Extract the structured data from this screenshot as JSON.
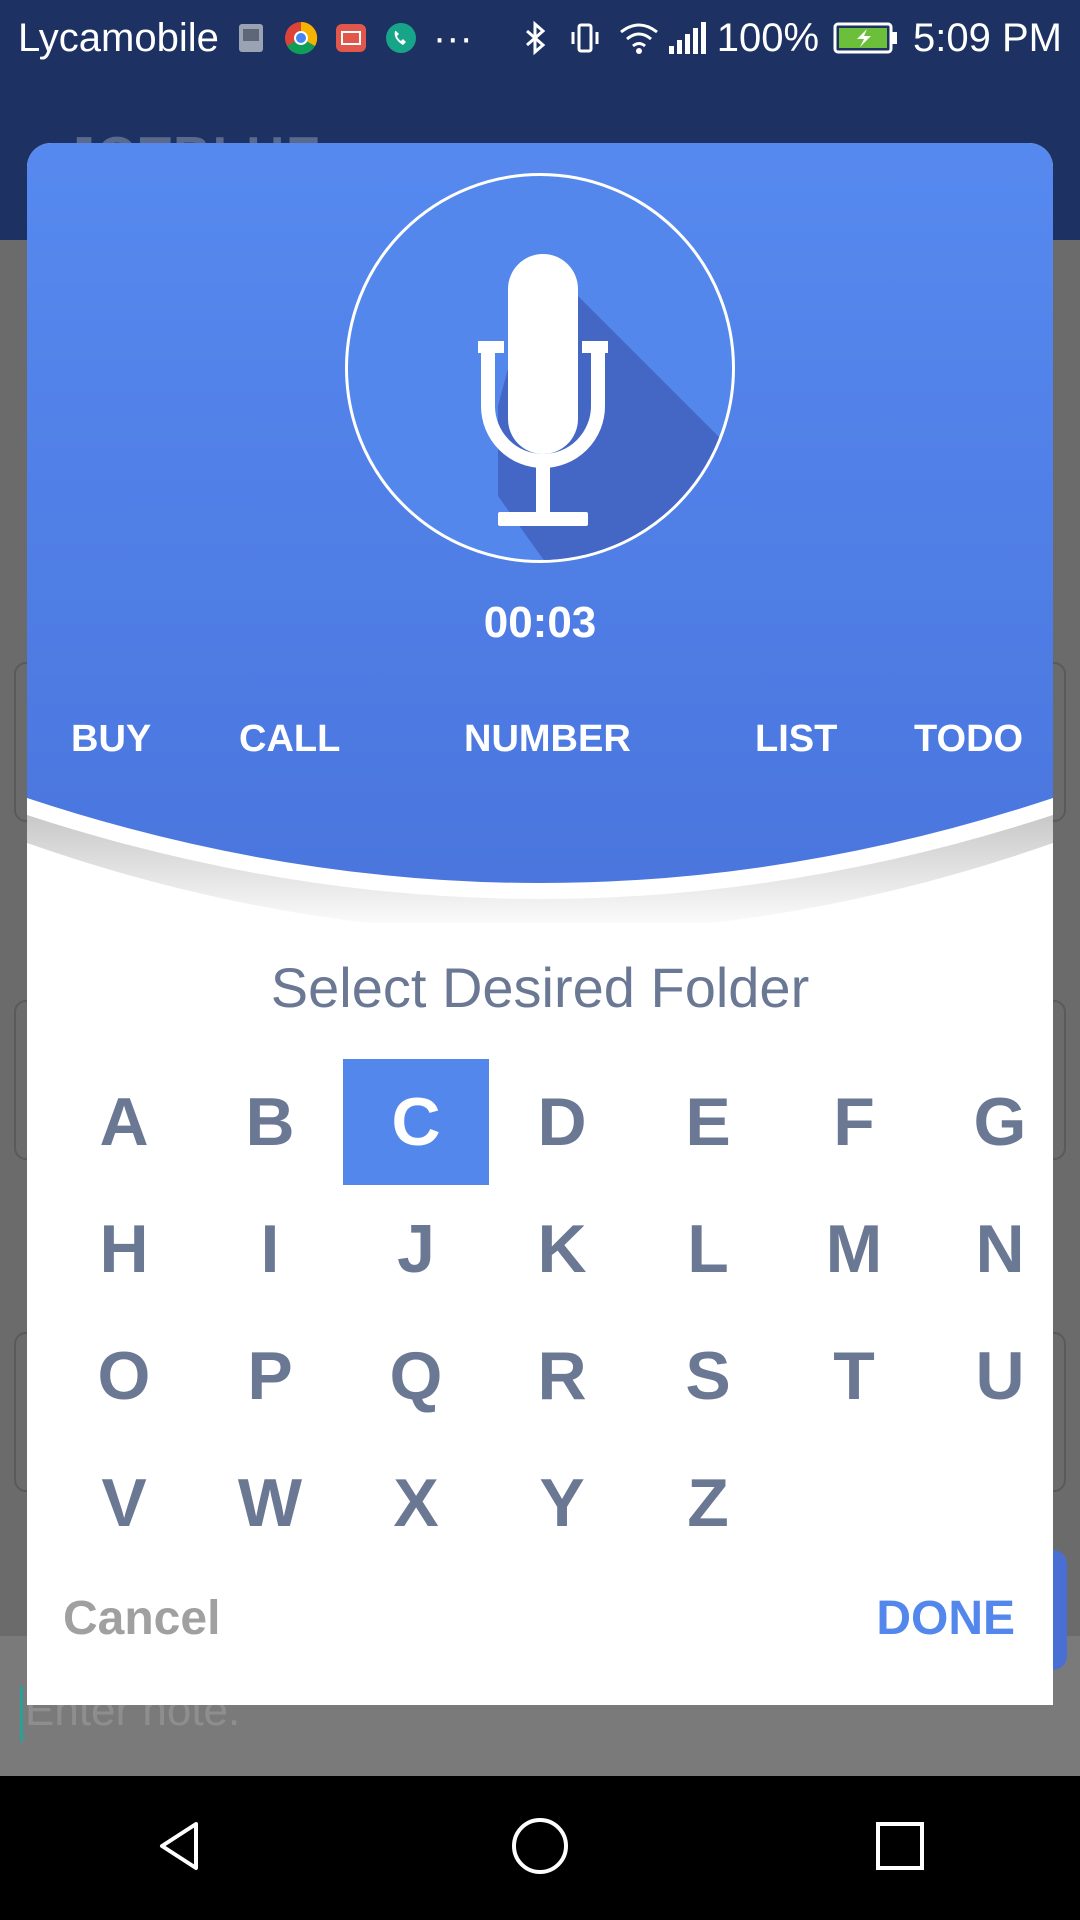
{
  "status_bar": {
    "carrier": "Lycamobile",
    "battery_percent": "100%",
    "time": "5:09 PM",
    "more_indicator": "···"
  },
  "app": {
    "title": "JOTBLUE",
    "note_placeholder": "Enter note."
  },
  "dialog": {
    "timer": "00:03",
    "keywords": [
      "BUY",
      "CALL",
      "NUMBER",
      "LIST",
      "TODO"
    ],
    "folder_title": "Select Desired Folder",
    "letters": [
      "A",
      "B",
      "C",
      "D",
      "E",
      "F",
      "G",
      "H",
      "I",
      "J",
      "K",
      "L",
      "M",
      "N",
      "O",
      "P",
      "Q",
      "R",
      "S",
      "T",
      "U",
      "V",
      "W",
      "X",
      "Y",
      "Z"
    ],
    "selected_letter": "C",
    "cancel_label": "Cancel",
    "done_label": "DONE"
  },
  "colors": {
    "accent": "#5487ec",
    "status_bar": "#1d3163",
    "letter": "#6b7894"
  },
  "icons": {
    "mic": "microphone-icon",
    "back": "back-triangle-icon",
    "home": "home-circle-icon",
    "recents": "recents-square-icon"
  }
}
